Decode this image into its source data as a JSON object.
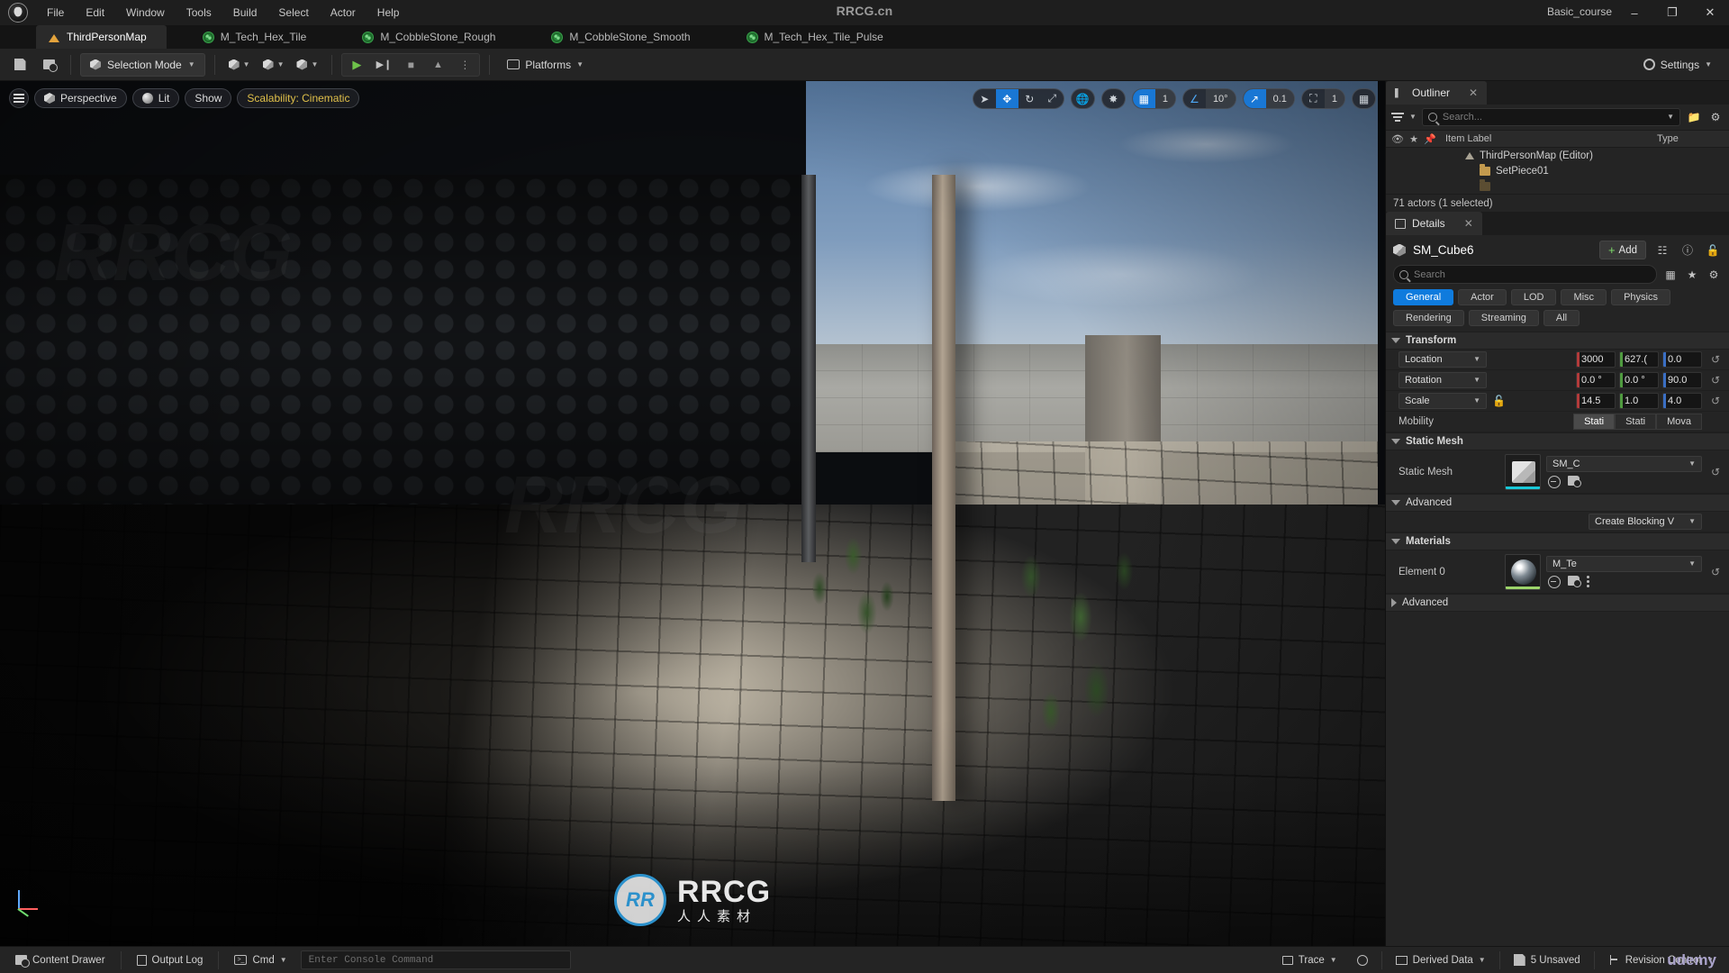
{
  "titlebar": {
    "logo": "unreal-engine-logo",
    "menus": [
      "File",
      "Edit",
      "Window",
      "Tools",
      "Build",
      "Select",
      "Actor",
      "Help"
    ],
    "window_title": "RRCG.cn",
    "project_name": "Basic_course",
    "window_controls": {
      "minimize": "–",
      "maximize": "❐",
      "close": "✕"
    }
  },
  "tabs": [
    {
      "label": "ThirdPersonMap",
      "icon": "map-icon",
      "active": true
    },
    {
      "label": "M_Tech_Hex_Tile",
      "icon": "material-icon",
      "active": false
    },
    {
      "label": "M_CobbleStone_Rough",
      "icon": "material-icon",
      "active": false
    },
    {
      "label": "M_CobbleStone_Smooth",
      "icon": "material-icon",
      "active": false
    },
    {
      "label": "M_Tech_Hex_Tile_Pulse",
      "icon": "material-icon",
      "active": false
    }
  ],
  "toolbar": {
    "save_label": "save-icon",
    "browse_label": "browse-icon",
    "mode_label": "Selection Mode",
    "add_label": "add-actor-icon",
    "blueprint_label": "blueprints-icon",
    "cinematics_label": "cinematics-icon",
    "play_label": "▶",
    "step_label": "▶❙",
    "stop_label": "■",
    "eject_label": "▲",
    "more_label": "⋮",
    "platforms_label": "Platforms",
    "settings_label": "Settings"
  },
  "viewport": {
    "left_controls": [
      {
        "label": "",
        "icon": "menu-hamburger-icon"
      },
      {
        "label": "Perspective",
        "icon": "perspective-cube-icon"
      },
      {
        "label": "Lit",
        "icon": "lit-sphere-icon"
      },
      {
        "label": "Show",
        "icon": ""
      },
      {
        "label": "Scalability: Cinematic",
        "icon": ""
      }
    ],
    "right_controls": {
      "select_tool": "select-arrow-icon",
      "move_tool": "move-gizmo-icon",
      "rotate_tool": "rotate-gizmo-icon",
      "scale_tool": "scale-gizmo-icon",
      "world_coords": "world-globe-icon",
      "surface_snap": "surface-snap-icon",
      "grid_snap_icon": "grid-snap-icon",
      "grid_snap_value": "1",
      "angle_snap_icon": "angle-snap-icon",
      "angle_snap_value": "10°",
      "scale_snap_icon": "scale-snap-icon",
      "scale_snap_value": "0.1",
      "camera_speed_icon": "camera-icon",
      "camera_speed_value": "1",
      "layout_icon": "viewport-layout-icon"
    }
  },
  "outliner": {
    "tab_label": "Outliner",
    "close_label": "✕",
    "search_placeholder": "Search...",
    "columns": [
      "Item Label",
      "Type"
    ],
    "rows": [
      {
        "label": "ThirdPersonMap (Editor)",
        "icon": "map-icon",
        "indent": 12,
        "type": ""
      },
      {
        "label": "SetPiece01",
        "icon": "folder-icon",
        "indent": 28,
        "type": ""
      }
    ],
    "status": "71 actors (1 selected)"
  },
  "details": {
    "tab_label": "Details",
    "close_label": "✕",
    "object_name": "SM_Cube6",
    "add_label": "Add",
    "search_placeholder": "Search",
    "filter_tabs": [
      {
        "label": "General",
        "active": true
      },
      {
        "label": "Actor",
        "active": false
      },
      {
        "label": "LOD",
        "active": false
      },
      {
        "label": "Misc",
        "active": false
      },
      {
        "label": "Physics",
        "active": false
      },
      {
        "label": "Rendering",
        "active": false
      },
      {
        "label": "Streaming",
        "active": false
      },
      {
        "label": "All",
        "active": false
      }
    ],
    "sections": {
      "transform": {
        "title": "Transform",
        "location": {
          "label": "Location",
          "x": "3000",
          "y": "627.(",
          "z": "0.0"
        },
        "rotation": {
          "label": "Rotation",
          "x": "0.0 °",
          "y": "0.0 °",
          "z": "90.0"
        },
        "scale": {
          "label": "Scale",
          "x": "14.5",
          "y": "1.0",
          "z": "4.0"
        },
        "mobility": {
          "label": "Mobility",
          "options": [
            "Stati",
            "Stati",
            "Mova"
          ],
          "selected_index": 0
        }
      },
      "static_mesh": {
        "title": "Static Mesh",
        "row_label": "Static Mesh",
        "asset_value": "SM_C",
        "advanced_label": "Advanced",
        "advanced_value": "Create Blocking V"
      },
      "materials": {
        "title": "Materials",
        "row_label": "Element 0",
        "asset_value": "M_Te",
        "advanced_label": "Advanced"
      }
    }
  },
  "statusbar": {
    "content_drawer": "Content Drawer",
    "output_log": "Output Log",
    "cmd_label": "Cmd",
    "console_placeholder": "Enter Console Command",
    "trace": "Trace",
    "derived_data": "Derived Data",
    "unsaved": "5 Unsaved",
    "revision_control": "Revision Control"
  },
  "watermarks": {
    "center_main": "RRCG",
    "center_sub": "人人素材",
    "center_logo": "RR",
    "corner": "udemy"
  },
  "colors": {
    "accent_blue": "#0f7bdd",
    "viewport_blue": "#1977d4",
    "scalability_yellow": "#e0c04a",
    "axis_x": "#b33a3a",
    "axis_y": "#4f9b3f",
    "axis_z": "#3a6fc4",
    "panel_bg": "#242424",
    "titlebar_bg": "#1e1e1e"
  }
}
